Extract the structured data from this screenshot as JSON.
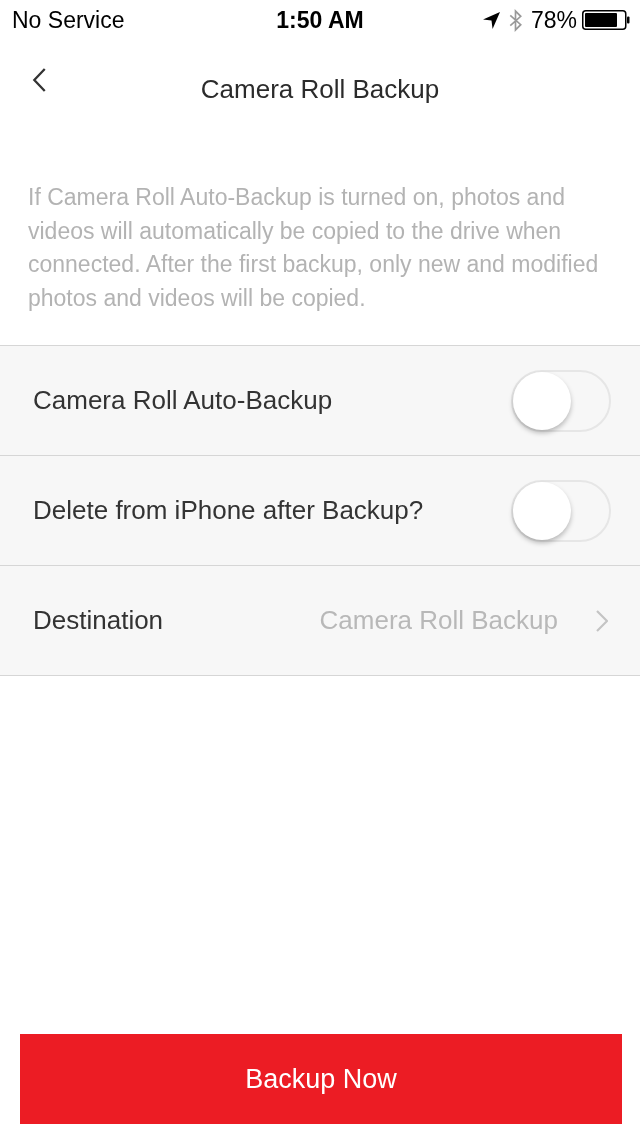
{
  "status_bar": {
    "carrier": "No Service",
    "time": "1:50 AM",
    "battery_percent": "78%"
  },
  "nav": {
    "title": "Camera Roll Backup"
  },
  "description": "If Camera Roll Auto-Backup is turned on, photos and videos will automatically be copied to the drive when connected. After the first backup, only new and modified photos and videos will be copied.",
  "settings": [
    {
      "kind": "toggle",
      "label": "Camera Roll Auto-Backup",
      "on": false
    },
    {
      "kind": "toggle",
      "label": "Delete from iPhone after Backup?",
      "on": false
    },
    {
      "kind": "link",
      "label": "Destination",
      "value": "Camera Roll Backup"
    }
  ],
  "primary_button": {
    "label": "Backup Now"
  }
}
